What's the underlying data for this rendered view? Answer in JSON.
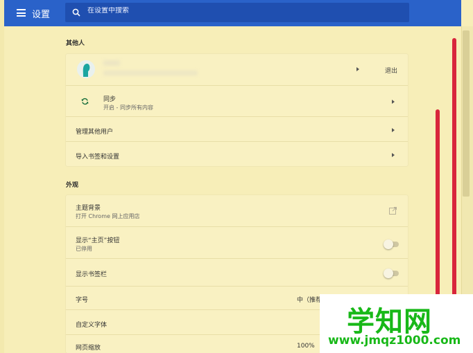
{
  "header": {
    "title": "设置",
    "search_placeholder": "在设置中搜索"
  },
  "people": {
    "section_title": "其他人",
    "signout_label": "退出",
    "sync_label": "同步",
    "sync_sub": "开启 - 同步所有内容",
    "manage_people": "管理其他用户",
    "import_label": "导入书签和设置"
  },
  "appearance": {
    "section_title": "外观",
    "theme_label": "主题背景",
    "theme_sub": "打开 Chrome 网上应用店",
    "home_button_label": "显示“主页”按钮",
    "home_button_sub": "已停用",
    "bookmarks_bar_label": "显示书签栏",
    "font_size_label": "字号",
    "font_size_value": "中（推荐）",
    "custom_fonts_label": "自定义字体",
    "zoom_label": "网页缩放",
    "zoom_value": "100%"
  },
  "watermark": {
    "big": "学知网",
    "small": "www.jmqz1000.com"
  },
  "colors": {
    "topbar": "#2a62c9",
    "background": "#f7eeb8",
    "annotation": "#d8263c",
    "watermark": "#18b818"
  },
  "icons": [
    "menu-icon",
    "search-icon",
    "avatar-icon",
    "sync-icon",
    "external-link-icon",
    "chevron-right-icon"
  ]
}
